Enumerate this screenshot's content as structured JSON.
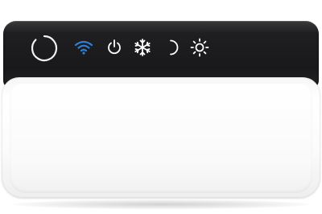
{
  "device": {
    "body_color": "#ffffff",
    "top_panel_color": "#1c1c1e",
    "icon_color_default": "#ffffff",
    "icon_color_active": "#2f7fd6"
  },
  "icons": [
    {
      "name": "power-ring-icon",
      "active": false
    },
    {
      "name": "wifi-icon",
      "active": true
    },
    {
      "name": "power-icon",
      "active": false
    },
    {
      "name": "snowflake-icon",
      "active": false
    },
    {
      "name": "moon-icon",
      "active": false
    },
    {
      "name": "sun-icon",
      "active": false
    }
  ]
}
